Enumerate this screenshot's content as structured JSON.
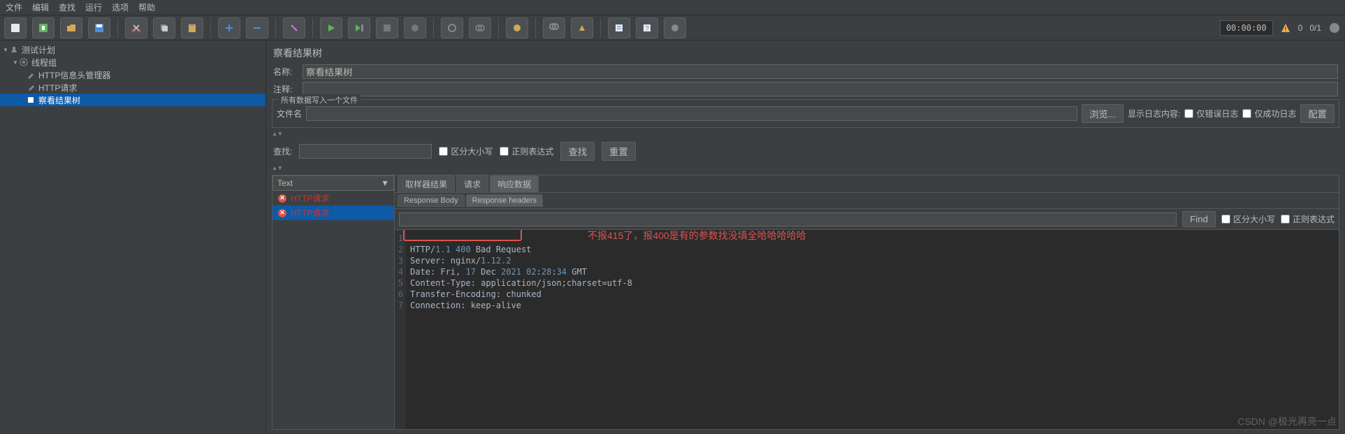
{
  "menu": {
    "file": "文件",
    "edit": "编辑",
    "search": "查找",
    "run": "运行",
    "options": "选项",
    "help": "帮助"
  },
  "toolbar": {
    "timer": "00:00:00",
    "warn_count": "0",
    "run_count": "0/1"
  },
  "tree": {
    "root": "测试计划",
    "group": "线程组",
    "header_mgr": "HTTP信息头管理器",
    "http_req": "HTTP请求",
    "view_results": "察看结果树"
  },
  "panel": {
    "title": "察看结果树",
    "name_label": "名称:",
    "name_value": "察看结果树",
    "comment_label": "注释:",
    "comment_value": "",
    "write_all_label": "所有数据写入一个文件",
    "filename_label": "文件名",
    "filename_value": "",
    "browse": "浏览...",
    "show_log_label": "显示日志内容:",
    "errors_only": "仅错误日志",
    "success_only": "仅成功日志",
    "configure": "配置"
  },
  "search": {
    "label": "查找:",
    "value": "",
    "case_sensitive": "区分大小写",
    "regex": "正则表达式",
    "search_btn": "查找",
    "reset_btn": "重置"
  },
  "results": {
    "dropdown": "Text",
    "items": [
      "HTTP请求",
      "HTTP请求"
    ],
    "tabs": {
      "sampler": "取样器结果",
      "request": "请求",
      "response": "响应数据"
    },
    "subtabs": {
      "body": "Response Body",
      "headers": "Response headers"
    },
    "find_btn": "Find",
    "find_case": "区分大小写",
    "find_regex": "正则表达式",
    "headers_text": {
      "l1_a": "HTTP/",
      "l1_b": "1.1 400",
      "l1_c": " Bad Request",
      "l2_a": "Server: nginx/",
      "l2_b": "1.12.2",
      "l3_a": "Date: Fri, ",
      "l3_b": "17",
      "l3_c": " Dec ",
      "l3_d": "2021 02",
      "l3_e": ":",
      "l3_f": "28",
      "l3_g": ":",
      "l3_h": "34",
      "l3_i": " GMT",
      "l4": "Content-Type: application/json;charset=utf-8",
      "l5": "Transfer-Encoding: chunked",
      "l6": "Connection: keep-alive"
    }
  },
  "annotation": "不报415了，报400是有的参数找没填全哈哈哈哈哈",
  "watermark": "CSDN @极光再亮一点",
  "line_numbers": [
    "1",
    "2",
    "3",
    "4",
    "5",
    "6",
    "7"
  ]
}
